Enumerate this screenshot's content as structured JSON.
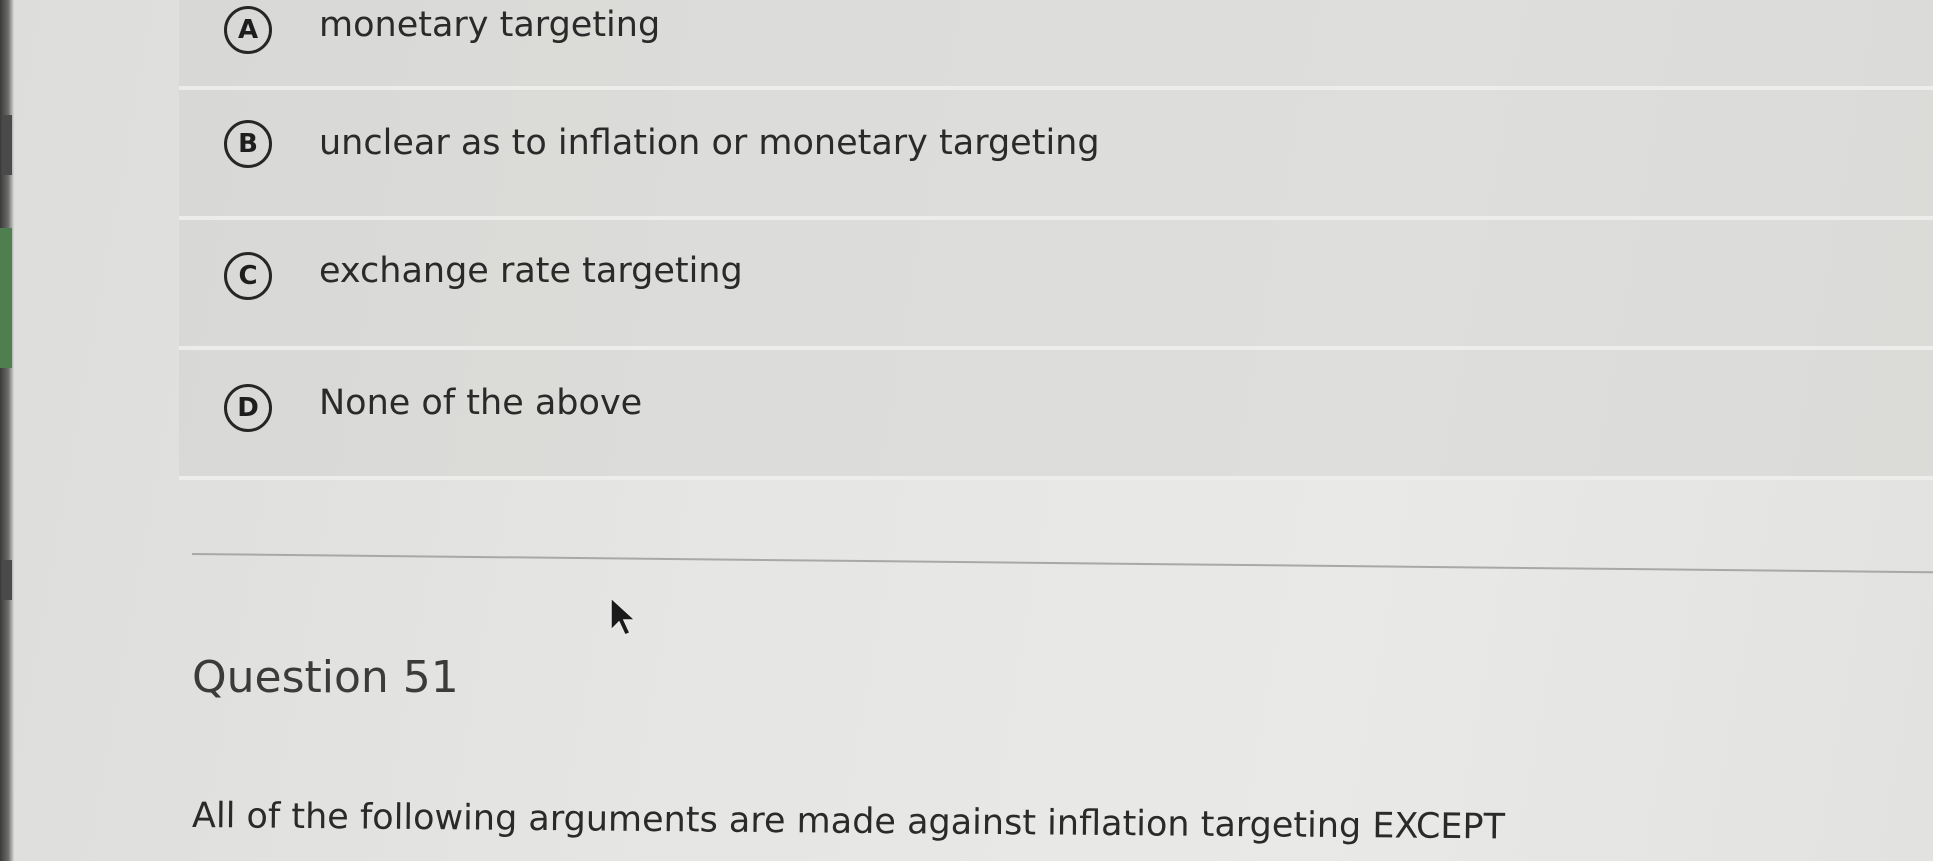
{
  "options": [
    {
      "letter": "A",
      "text": "monetary targeting"
    },
    {
      "letter": "B",
      "text": "unclear as to inflation or monetary targeting"
    },
    {
      "letter": "C",
      "text": "exchange rate targeting"
    },
    {
      "letter": "D",
      "text": "None of the above"
    }
  ],
  "question": {
    "title": "Question 51",
    "text": "All of the following arguments are made against inflation targeting EXCEPT"
  }
}
